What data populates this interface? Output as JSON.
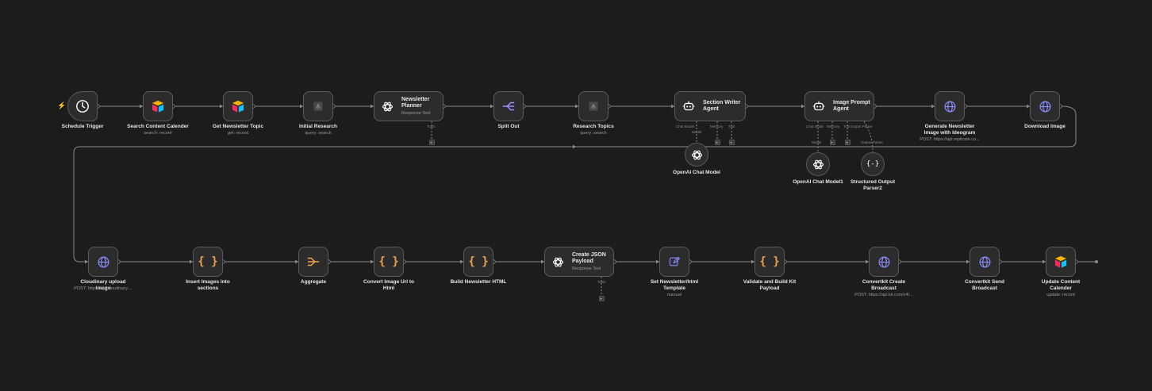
{
  "workflow": {
    "nodes": [
      {
        "id": "schedule",
        "title": "Schedule Trigger",
        "subtitle": "",
        "icon": "clock-icon",
        "kind": "trigger"
      },
      {
        "id": "search_calendar",
        "title": "Search Content Calender",
        "subtitle": "search: record",
        "icon": "airtable-icon",
        "kind": "box"
      },
      {
        "id": "get_topic",
        "title": "Get Newsletter Topic",
        "subtitle": "get: record",
        "icon": "airtable-icon",
        "kind": "box"
      },
      {
        "id": "initial_research",
        "title": "Initial Research",
        "subtitle": "query: search",
        "icon": "perplexity-icon",
        "kind": "box"
      },
      {
        "id": "planner",
        "title": "Newsletter Planner",
        "subtitle": "Response Text",
        "icon": "openai-icon",
        "kind": "wide"
      },
      {
        "id": "split_out",
        "title": "Split Out",
        "subtitle": "",
        "icon": "split-icon",
        "kind": "box"
      },
      {
        "id": "research_topics",
        "title": "Research Topics",
        "subtitle": "query: search",
        "icon": "perplexity-icon",
        "kind": "box"
      },
      {
        "id": "section_writer",
        "title": "Section Writer Agent",
        "subtitle": "",
        "icon": "robot-icon",
        "kind": "wide"
      },
      {
        "id": "image_prompt",
        "title": "Image Prompt Agent",
        "subtitle": "",
        "icon": "robot-icon",
        "kind": "wide"
      },
      {
        "id": "gen_image",
        "title": "Generate Newsletter Image with Ideogram",
        "subtitle": "POST: https://api.replicate.co...",
        "icon": "globe-icon",
        "kind": "box"
      },
      {
        "id": "download_image",
        "title": "Download Image",
        "subtitle": "",
        "icon": "globe-icon",
        "kind": "box"
      },
      {
        "id": "openai_model",
        "title": "OpenAI Chat Model",
        "subtitle": "",
        "icon": "openai-icon",
        "kind": "circle"
      },
      {
        "id": "openai_model1",
        "title": "OpenAI Chat Model1",
        "subtitle": "",
        "icon": "openai-icon",
        "kind": "circle"
      },
      {
        "id": "parser",
        "title": "Structured Output Parser2",
        "subtitle": "",
        "icon": "braces-icon",
        "kind": "circle"
      },
      {
        "id": "cloudinary",
        "title": "Cloudinary upload image",
        "subtitle": "POST: https://api.cloudinary....",
        "icon": "globe-icon",
        "kind": "box"
      },
      {
        "id": "insert_images",
        "title": "Insert Images into sections",
        "subtitle": "",
        "icon": "code-icon",
        "kind": "box"
      },
      {
        "id": "aggregate",
        "title": "Aggregate",
        "subtitle": "",
        "icon": "aggregate-icon",
        "kind": "box"
      },
      {
        "id": "convert_url",
        "title": "Convert Image Url to Html",
        "subtitle": "",
        "icon": "code-icon",
        "kind": "box"
      },
      {
        "id": "build_html",
        "title": "Build Newsletter HTML",
        "subtitle": "",
        "icon": "code-icon",
        "kind": "box"
      },
      {
        "id": "create_json",
        "title": "Create JSON Payload",
        "subtitle": "Response Text",
        "icon": "openai-icon",
        "kind": "wide"
      },
      {
        "id": "set_template",
        "title": "Set Newsletter/html Template",
        "subtitle": "manual",
        "icon": "pencil-icon",
        "kind": "box"
      },
      {
        "id": "validate",
        "title": "Validate and Build Kit Payload",
        "subtitle": "",
        "icon": "code-icon",
        "kind": "box"
      },
      {
        "id": "kit_create",
        "title": "Convertkit Create Broadcast",
        "subtitle": "POST: https://api.kit.com/v4/...",
        "icon": "globe-icon",
        "kind": "box"
      },
      {
        "id": "kit_send",
        "title": "Convertkit Send Broadcast",
        "subtitle": "",
        "icon": "globe-icon",
        "kind": "box"
      },
      {
        "id": "update_calendar",
        "title": "Update Content Calender",
        "subtitle": "update: record",
        "icon": "airtable-icon",
        "kind": "box"
      }
    ],
    "port_labels": {
      "tools": "Tools",
      "chat_model": "Chat Model",
      "chat_model_req": "*",
      "model": "Model",
      "memory": "Memory",
      "tool": "Tool",
      "chat_mode": "Chat Mode",
      "memory2": "Memory",
      "tool2": "Tool",
      "output_parser": "Output Parser",
      "model2": "Model",
      "output_parser2": "Output Parser"
    },
    "colors": {
      "background": "#1c1c1c",
      "node": "#2c2c2c",
      "edge": "#8a8a8a",
      "trigger": "#ff6d3a",
      "openai": "#ffffff",
      "http": "#8c8cff",
      "code": "#f0a24b",
      "split": "#a88cff"
    }
  }
}
